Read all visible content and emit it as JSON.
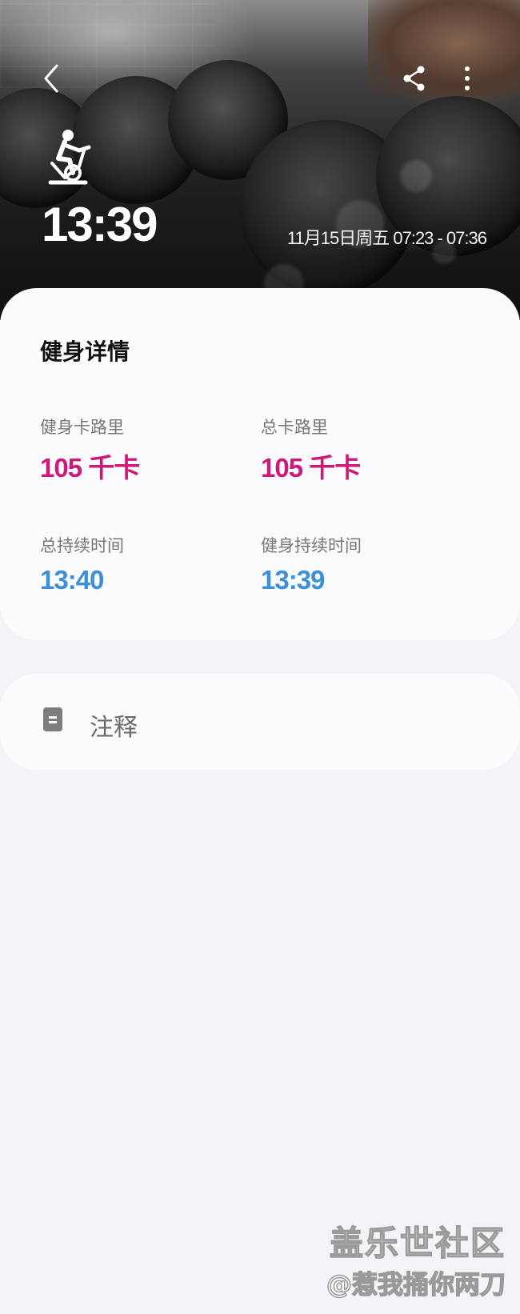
{
  "header": {
    "workout_duration": "13:39",
    "date_time_range": "11月15日周五 07:23 - 07:36",
    "icons": {
      "back": "chevron-left-icon",
      "share": "share-icon",
      "more": "more-vertical-icon",
      "sport": "exercise-bike-icon"
    }
  },
  "details": {
    "title": "健身详情",
    "metrics": [
      {
        "label": "健身卡路里",
        "value": "105 千卡"
      },
      {
        "label": "总卡路里",
        "value": "105 千卡"
      },
      {
        "label": "总持续时间",
        "value": "13:40"
      },
      {
        "label": "健身持续时间",
        "value": "13:39"
      }
    ]
  },
  "notes": {
    "label": "注释",
    "icon": "note-icon"
  },
  "watermark": {
    "title": "盖乐世社区",
    "user": "@惹我捅你两刀"
  },
  "colors": {
    "calorie_value": "#cc1a78",
    "time_value": "#3d8fd6",
    "page_background": "#f4f4f8",
    "card_background": "#fbfbfd"
  }
}
